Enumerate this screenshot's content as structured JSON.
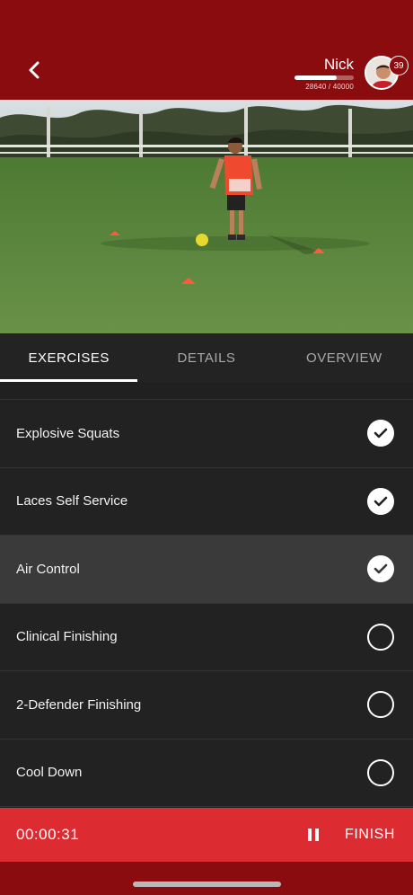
{
  "header": {
    "back_icon": "chevron-left-icon",
    "user_name": "Nick",
    "xp_text": "28640 / 40000",
    "xp_progress": 0.716,
    "level": "39",
    "accent_color": "#8a0c0f"
  },
  "tabs": [
    {
      "label": "EXERCISES",
      "active": true
    },
    {
      "label": "DETAILS",
      "active": false
    },
    {
      "label": "OVERVIEW",
      "active": false
    }
  ],
  "exercises": [
    {
      "label": "Explosive Squats",
      "completed": true
    },
    {
      "label": "Laces Self Service",
      "completed": true
    },
    {
      "label": "Air Control",
      "completed": true,
      "current": true
    },
    {
      "label": "Clinical Finishing",
      "completed": false
    },
    {
      "label": "2-Defender Finishing",
      "completed": false
    },
    {
      "label": "Cool Down",
      "completed": false
    }
  ],
  "footer": {
    "timer": "00:00:31",
    "pause_icon": "pause-icon",
    "finish_label": "FINISH",
    "color": "#dc2b31"
  }
}
